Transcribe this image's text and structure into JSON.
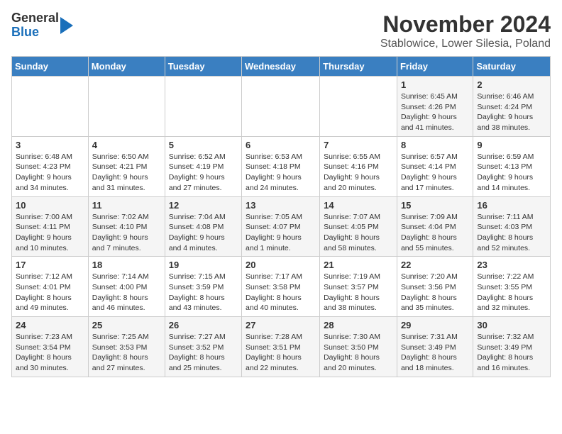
{
  "header": {
    "logo_line1": "General",
    "logo_line2": "Blue",
    "title": "November 2024",
    "subtitle": "Stablowice, Lower Silesia, Poland"
  },
  "columns": [
    "Sunday",
    "Monday",
    "Tuesday",
    "Wednesday",
    "Thursday",
    "Friday",
    "Saturday"
  ],
  "weeks": [
    {
      "days": [
        {
          "num": "",
          "info": ""
        },
        {
          "num": "",
          "info": ""
        },
        {
          "num": "",
          "info": ""
        },
        {
          "num": "",
          "info": ""
        },
        {
          "num": "",
          "info": ""
        },
        {
          "num": "1",
          "info": "Sunrise: 6:45 AM\nSunset: 4:26 PM\nDaylight: 9 hours and 41 minutes."
        },
        {
          "num": "2",
          "info": "Sunrise: 6:46 AM\nSunset: 4:24 PM\nDaylight: 9 hours and 38 minutes."
        }
      ]
    },
    {
      "days": [
        {
          "num": "3",
          "info": "Sunrise: 6:48 AM\nSunset: 4:23 PM\nDaylight: 9 hours and 34 minutes."
        },
        {
          "num": "4",
          "info": "Sunrise: 6:50 AM\nSunset: 4:21 PM\nDaylight: 9 hours and 31 minutes."
        },
        {
          "num": "5",
          "info": "Sunrise: 6:52 AM\nSunset: 4:19 PM\nDaylight: 9 hours and 27 minutes."
        },
        {
          "num": "6",
          "info": "Sunrise: 6:53 AM\nSunset: 4:18 PM\nDaylight: 9 hours and 24 minutes."
        },
        {
          "num": "7",
          "info": "Sunrise: 6:55 AM\nSunset: 4:16 PM\nDaylight: 9 hours and 20 minutes."
        },
        {
          "num": "8",
          "info": "Sunrise: 6:57 AM\nSunset: 4:14 PM\nDaylight: 9 hours and 17 minutes."
        },
        {
          "num": "9",
          "info": "Sunrise: 6:59 AM\nSunset: 4:13 PM\nDaylight: 9 hours and 14 minutes."
        }
      ]
    },
    {
      "days": [
        {
          "num": "10",
          "info": "Sunrise: 7:00 AM\nSunset: 4:11 PM\nDaylight: 9 hours and 10 minutes."
        },
        {
          "num": "11",
          "info": "Sunrise: 7:02 AM\nSunset: 4:10 PM\nDaylight: 9 hours and 7 minutes."
        },
        {
          "num": "12",
          "info": "Sunrise: 7:04 AM\nSunset: 4:08 PM\nDaylight: 9 hours and 4 minutes."
        },
        {
          "num": "13",
          "info": "Sunrise: 7:05 AM\nSunset: 4:07 PM\nDaylight: 9 hours and 1 minute."
        },
        {
          "num": "14",
          "info": "Sunrise: 7:07 AM\nSunset: 4:05 PM\nDaylight: 8 hours and 58 minutes."
        },
        {
          "num": "15",
          "info": "Sunrise: 7:09 AM\nSunset: 4:04 PM\nDaylight: 8 hours and 55 minutes."
        },
        {
          "num": "16",
          "info": "Sunrise: 7:11 AM\nSunset: 4:03 PM\nDaylight: 8 hours and 52 minutes."
        }
      ]
    },
    {
      "days": [
        {
          "num": "17",
          "info": "Sunrise: 7:12 AM\nSunset: 4:01 PM\nDaylight: 8 hours and 49 minutes."
        },
        {
          "num": "18",
          "info": "Sunrise: 7:14 AM\nSunset: 4:00 PM\nDaylight: 8 hours and 46 minutes."
        },
        {
          "num": "19",
          "info": "Sunrise: 7:15 AM\nSunset: 3:59 PM\nDaylight: 8 hours and 43 minutes."
        },
        {
          "num": "20",
          "info": "Sunrise: 7:17 AM\nSunset: 3:58 PM\nDaylight: 8 hours and 40 minutes."
        },
        {
          "num": "21",
          "info": "Sunrise: 7:19 AM\nSunset: 3:57 PM\nDaylight: 8 hours and 38 minutes."
        },
        {
          "num": "22",
          "info": "Sunrise: 7:20 AM\nSunset: 3:56 PM\nDaylight: 8 hours and 35 minutes."
        },
        {
          "num": "23",
          "info": "Sunrise: 7:22 AM\nSunset: 3:55 PM\nDaylight: 8 hours and 32 minutes."
        }
      ]
    },
    {
      "days": [
        {
          "num": "24",
          "info": "Sunrise: 7:23 AM\nSunset: 3:54 PM\nDaylight: 8 hours and 30 minutes."
        },
        {
          "num": "25",
          "info": "Sunrise: 7:25 AM\nSunset: 3:53 PM\nDaylight: 8 hours and 27 minutes."
        },
        {
          "num": "26",
          "info": "Sunrise: 7:27 AM\nSunset: 3:52 PM\nDaylight: 8 hours and 25 minutes."
        },
        {
          "num": "27",
          "info": "Sunrise: 7:28 AM\nSunset: 3:51 PM\nDaylight: 8 hours and 22 minutes."
        },
        {
          "num": "28",
          "info": "Sunrise: 7:30 AM\nSunset: 3:50 PM\nDaylight: 8 hours and 20 minutes."
        },
        {
          "num": "29",
          "info": "Sunrise: 7:31 AM\nSunset: 3:49 PM\nDaylight: 8 hours and 18 minutes."
        },
        {
          "num": "30",
          "info": "Sunrise: 7:32 AM\nSunset: 3:49 PM\nDaylight: 8 hours and 16 minutes."
        }
      ]
    }
  ]
}
